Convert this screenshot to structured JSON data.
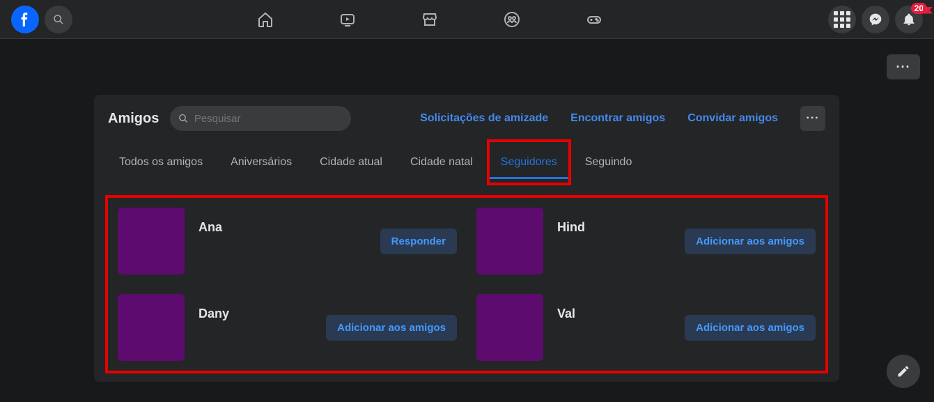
{
  "notifications": {
    "badge": "20"
  },
  "page": {
    "title": "Amigos",
    "search_placeholder": "Pesquisar",
    "links": {
      "requests": "Solicitações de amizade",
      "find": "Encontrar amigos",
      "invite": "Convidar amigos"
    }
  },
  "tabs": [
    {
      "label": "Todos os amigos",
      "active": false
    },
    {
      "label": "Aniversários",
      "active": false
    },
    {
      "label": "Cidade atual",
      "active": false
    },
    {
      "label": "Cidade natal",
      "active": false
    },
    {
      "label": "Seguidores",
      "active": true
    },
    {
      "label": "Seguindo",
      "active": false
    }
  ],
  "followers": [
    {
      "name": "Ana",
      "action": "Responder",
      "avatar_color": "#5e0b6f"
    },
    {
      "name": "Hind",
      "action": "Adicionar aos amigos",
      "avatar_color": "#5e0b6f"
    },
    {
      "name": "Dany",
      "action": "Adicionar aos amigos",
      "avatar_color": "#5e0b6f"
    },
    {
      "name": "Val",
      "action": "Adicionar aos amigos",
      "avatar_color": "#5e0b6f"
    }
  ]
}
